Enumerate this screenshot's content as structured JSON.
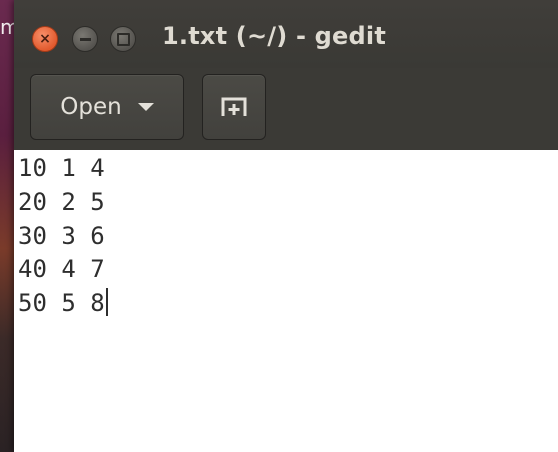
{
  "desktop": {
    "text": "m"
  },
  "window": {
    "title": "1.txt (~/) - gedit",
    "close_glyph": "×"
  },
  "toolbar": {
    "open_label": "Open",
    "open_icon": "chevron-down-icon",
    "new_tab_icon": "new-tab-icon"
  },
  "editor": {
    "lines": [
      "10 1 4",
      "20 2 5",
      "30 3 6",
      "40 4 7",
      "50 5 8"
    ]
  },
  "colors": {
    "close": "#e25a2e",
    "titlebar": "#3c3b37",
    "editor_bg": "#ffffff"
  }
}
